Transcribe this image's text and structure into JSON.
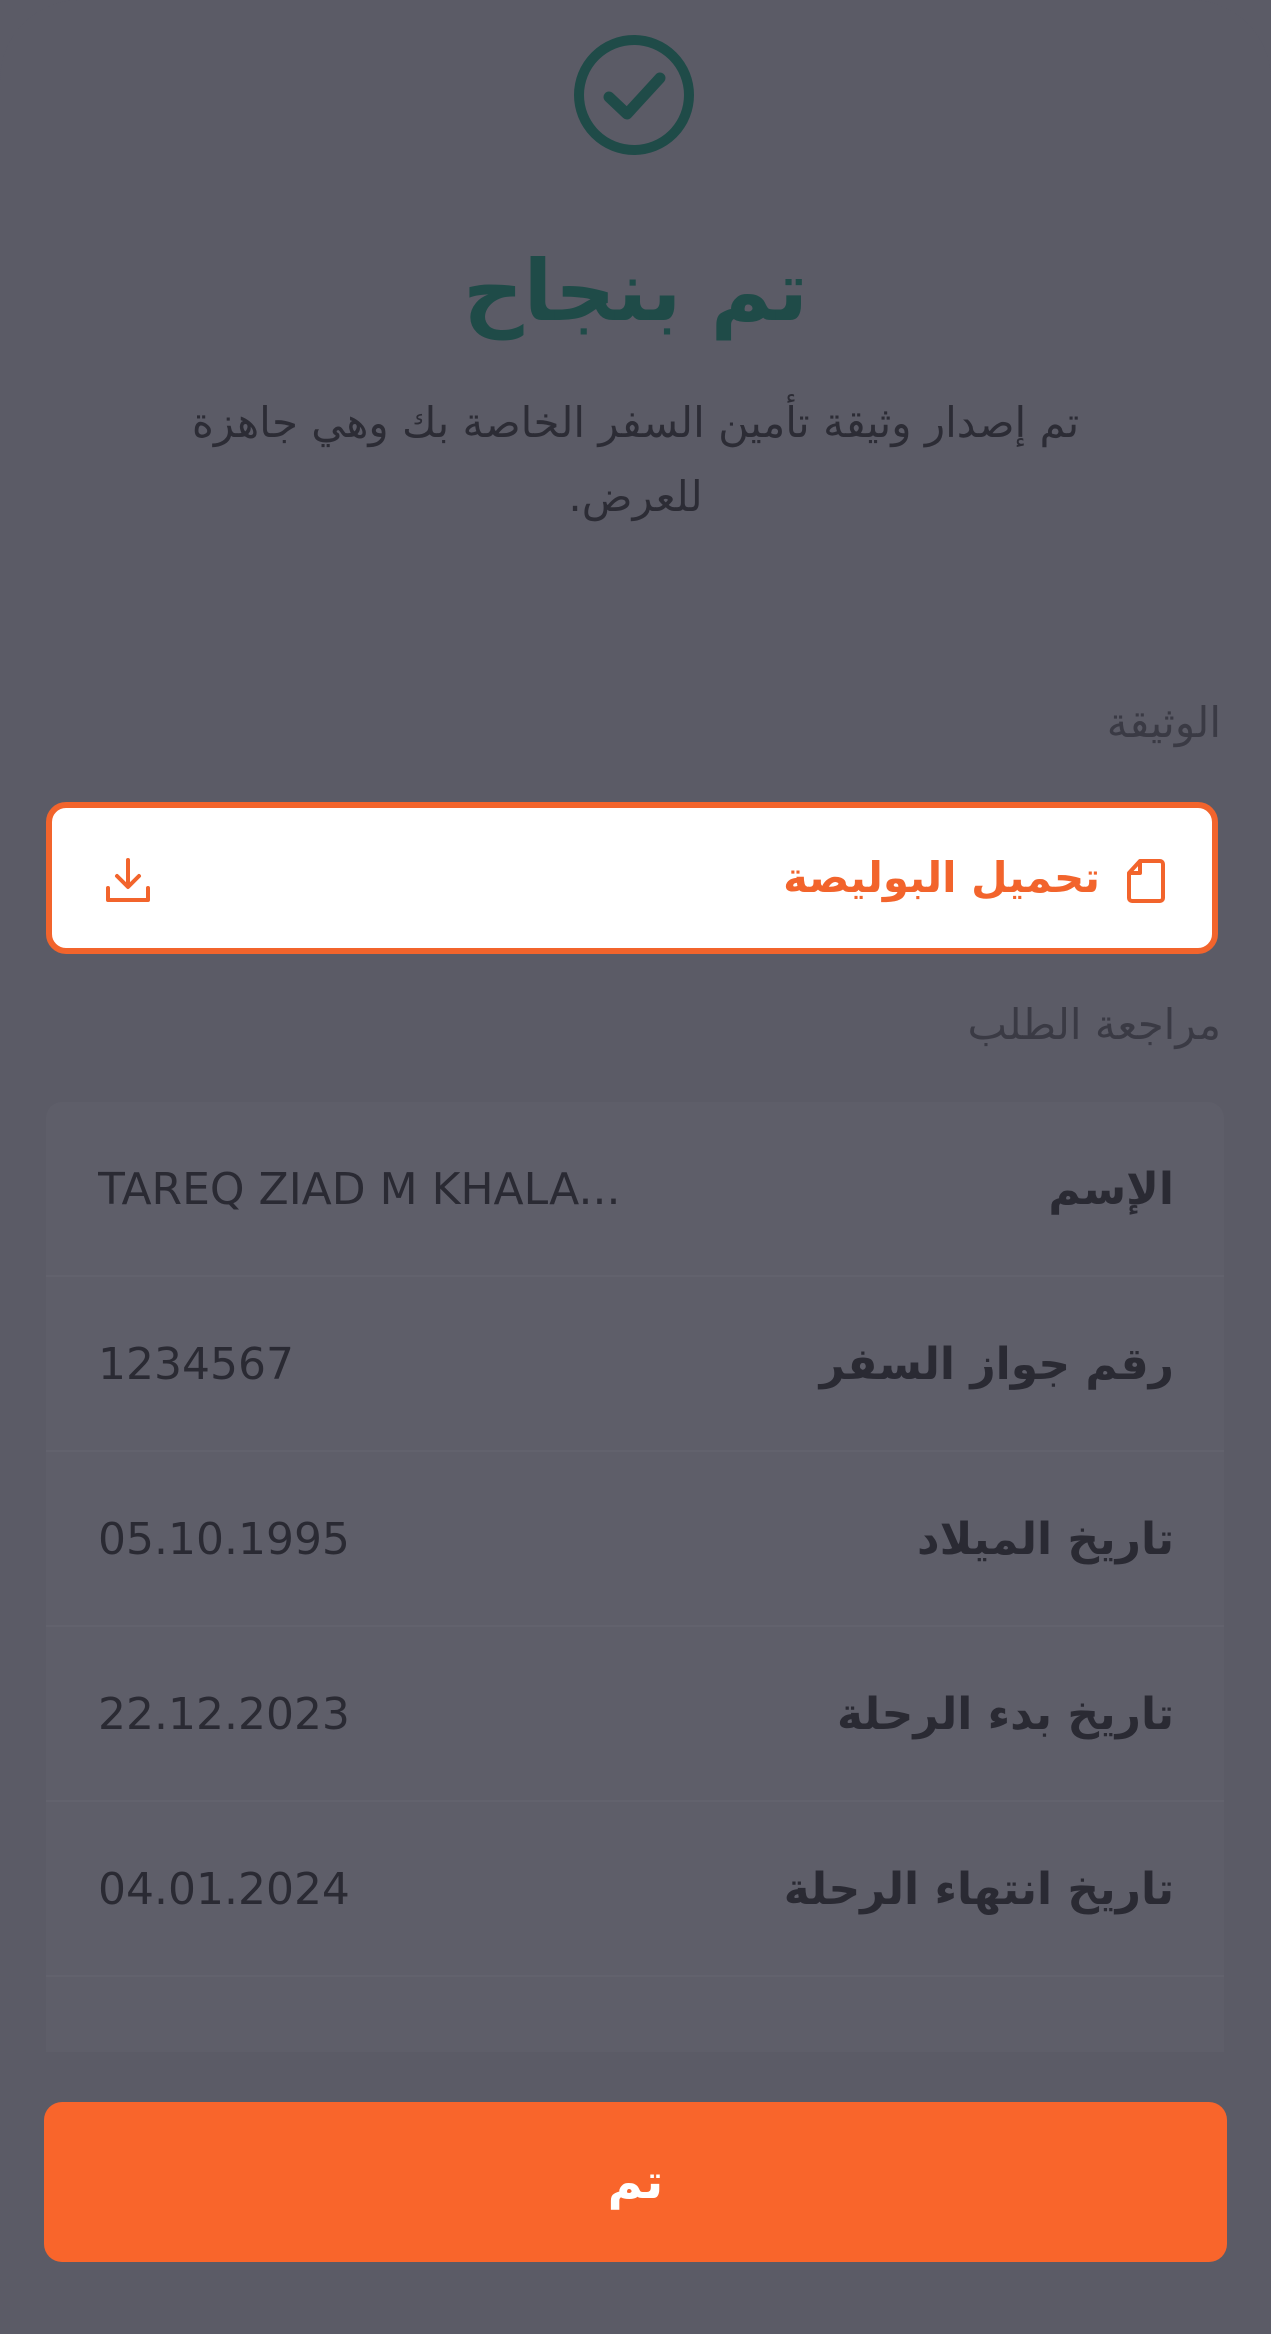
{
  "success": {
    "title": "تم بنجاح",
    "message": "تم إصدار وثيقة تأمين السفر الخاصة بك وهي جاهزة للعرض."
  },
  "document_section": {
    "label": "الوثيقة",
    "download_label": "تحميل البوليصة",
    "doc_icon": "document-icon",
    "download_icon": "download-icon"
  },
  "review_section": {
    "label": "مراجعة الطلب",
    "rows": [
      {
        "key": "الإسم",
        "value": "TAREQ ZIAD M KHALA..."
      },
      {
        "key": "رقم جواز السفر",
        "value": "1234567"
      },
      {
        "key": "تاريخ الميلاد",
        "value": "05.10.1995"
      },
      {
        "key": "تاريخ بدء الرحلة",
        "value": "22.12.2023"
      },
      {
        "key": "تاريخ انتهاء الرحلة",
        "value": "04.01.2024"
      }
    ]
  },
  "footer": {
    "done_label": "تم"
  },
  "colors": {
    "accent": "#f9652b",
    "success": "#1f4b48",
    "overlay": "#5b5b66"
  }
}
